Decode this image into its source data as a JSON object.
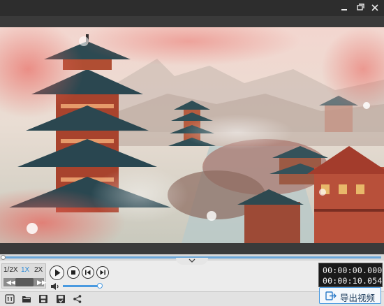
{
  "window": {
    "minimize_icon": "minimize-icon",
    "restore_icon": "restore-icon",
    "close_icon": "close-icon"
  },
  "video": {
    "content": "chinese-pagoda-landscape-frame",
    "playback_progress": 0
  },
  "speed": {
    "options": [
      "1/2X",
      "1X",
      "2X"
    ],
    "selected": "1X",
    "accent": "#2a8ad8"
  },
  "playback": {
    "play_icon": "play-icon",
    "stop_icon": "stop-icon",
    "prev_icon": "prev-frame-icon",
    "next_icon": "next-frame-icon",
    "volume_level": 1.0
  },
  "time": {
    "current": "00:00:00.000",
    "total": "00:00:10.054"
  },
  "toolbar": {
    "tools": [
      "subtitle-icon",
      "open-folder-icon",
      "save-icon",
      "save-as-icon",
      "share-icon"
    ],
    "export_label": "导出视频",
    "export_icon": "export-video-icon"
  },
  "colors": {
    "accent": "#4a9ae0",
    "timeline": "#6aa6d8",
    "window_bg": "#2b2b2b"
  }
}
